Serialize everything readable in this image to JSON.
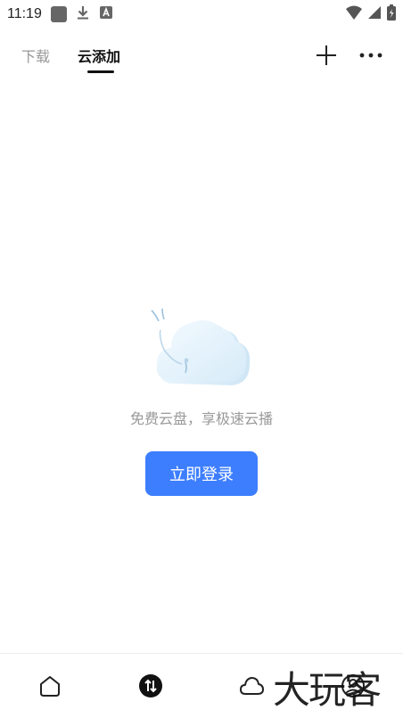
{
  "status_bar": {
    "time": "11:19",
    "left_icons": [
      "square-icon",
      "download-icon",
      "a-badge-icon"
    ],
    "right_icons": [
      "wifi-icon",
      "signal-icon",
      "battery-icon"
    ]
  },
  "tabs": [
    {
      "label": "下载",
      "active": false
    },
    {
      "label": "云添加",
      "active": true
    }
  ],
  "header_actions": {
    "add_icon": "plus-icon",
    "more_icon": "more-icon"
  },
  "empty_state": {
    "message": "免费云盘，享极速云播",
    "login_button": "立即登录"
  },
  "bottom_nav": [
    {
      "icon": "home-icon"
    },
    {
      "icon": "transfer-icon"
    },
    {
      "icon": "cloud-icon"
    },
    {
      "icon": "profile-icon"
    }
  ],
  "watermark": "大玩客",
  "colors": {
    "accent": "#3d7eff",
    "text_muted": "#999999",
    "text_primary": "#111111"
  }
}
